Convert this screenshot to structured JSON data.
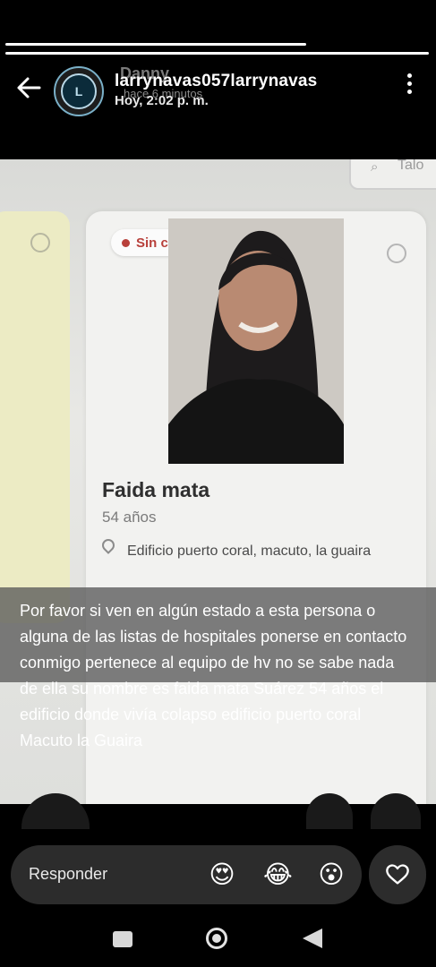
{
  "story": {
    "progress": {
      "segments": 2,
      "current_fraction": 0.71
    },
    "header": {
      "avatar_initial": "L",
      "ghost_name": "Danny",
      "username": "larrynavas057larrynavas",
      "ghost_time": "hace 6 minutos",
      "timestamp": "Hoy, 2:02 p. m."
    },
    "photo": {
      "search_label": "Talo",
      "badge": "Sin contacto",
      "name": "Faida mata",
      "age": "54 años",
      "location": "Edificio puerto coral, macuto, la guaira"
    },
    "caption": "Por favor si ven en algún estado a esta persona o alguna de las listas de hospitales ponerse en contacto conmigo pertenece al equipo de hv  no se sabe nada de ella su nombre es faida mata Suárez 54 años  el edificio donde vivía colapso  edificio puerto coral Macuto la Guaira"
  },
  "reply_bar": {
    "placeholder": "Responder",
    "reactions": [
      "😍",
      "😂",
      "😮"
    ]
  },
  "icons": {
    "back": "arrow-left-icon",
    "menu": "more-vertical-icon",
    "like": "heart-icon",
    "pin": "map-pin-icon",
    "clock": "clock-icon"
  },
  "colors": {
    "badge_red": "#b8403b",
    "avatar_ring": "#7ab0c8"
  }
}
